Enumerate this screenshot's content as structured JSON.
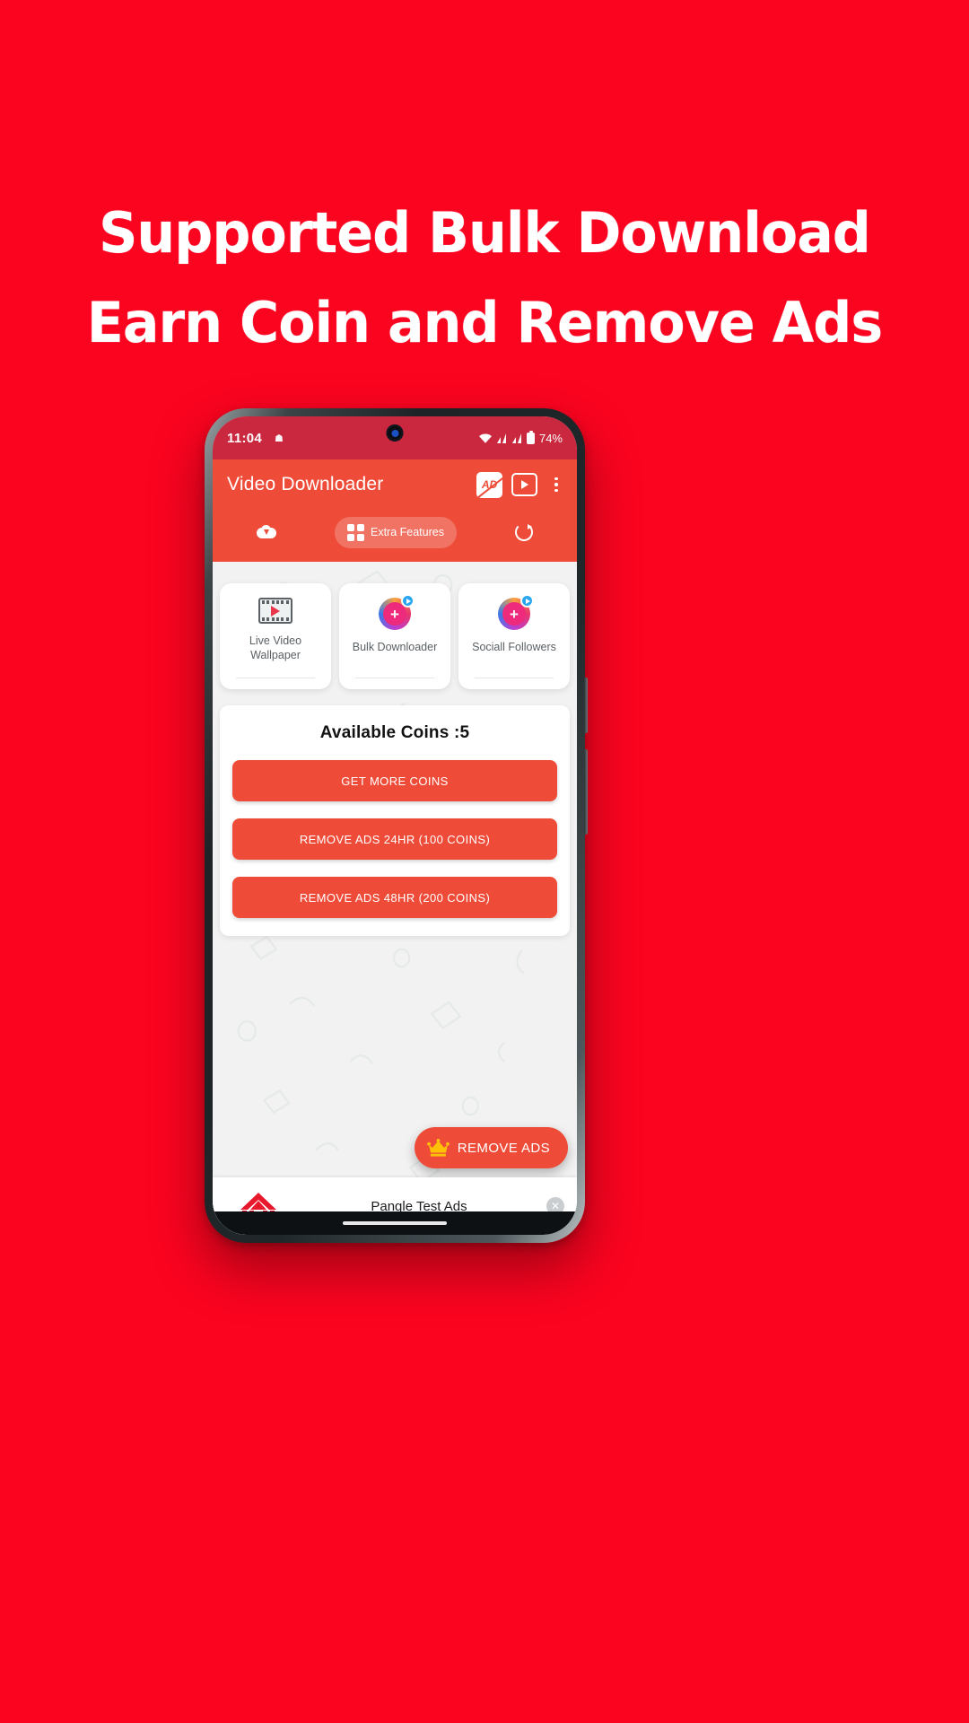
{
  "promo": {
    "background_color": "#FB0420",
    "headline_lines": [
      "Supported Bulk Download",
      "Earn Coin and Remove Ads"
    ]
  },
  "phone": {
    "status_bar": {
      "time": "11:04",
      "battery_percent": "74%",
      "wifi_icon": "wifi-icon",
      "signal_icon": "signal-icon",
      "battery_icon": "battery-icon",
      "notification_icon": "notification-icon",
      "camera_icon": "front-camera-icon"
    },
    "app_bar": {
      "title": "Video Downloader",
      "remove_ads_icon": "ads-blocked-icon",
      "remove_ads_icon_text": "AD",
      "video_icon": "video-player-icon",
      "overflow_icon": "overflow-menu-icon",
      "background_color": "#EE4C38"
    },
    "tabs": [
      {
        "label": "",
        "icon": "cloud-download-icon",
        "active": false
      },
      {
        "label": "Extra Features",
        "icon": "puzzle-icon",
        "active": true
      },
      {
        "label": "",
        "icon": "refresh-history-icon",
        "active": false
      }
    ],
    "feature_cards": [
      {
        "label": "Live Video Wallpaper",
        "icon": "film-play-icon"
      },
      {
        "label": "Bulk Downloader",
        "icon": "instagram-plus-icon"
      },
      {
        "label": "Sociall Followers",
        "icon": "instagram-plus-icon"
      }
    ],
    "coins_panel": {
      "title": "Available Coins :5",
      "buttons": [
        "GET MORE COINS",
        "REMOVE ADS 24HR (100 COINS)",
        "REMOVE ADS 48HR (200 COINS)"
      ],
      "accent_color": "#EE4C38"
    },
    "fab": {
      "label": "REMOVE ADS",
      "icon": "crown-icon",
      "crown_color": "#FFC107"
    },
    "ad_banner": {
      "network": "Pangle",
      "text": "Pangle Test Ads",
      "close_icon": "close-icon",
      "logo_icon": "pangle-logo-icon"
    }
  }
}
